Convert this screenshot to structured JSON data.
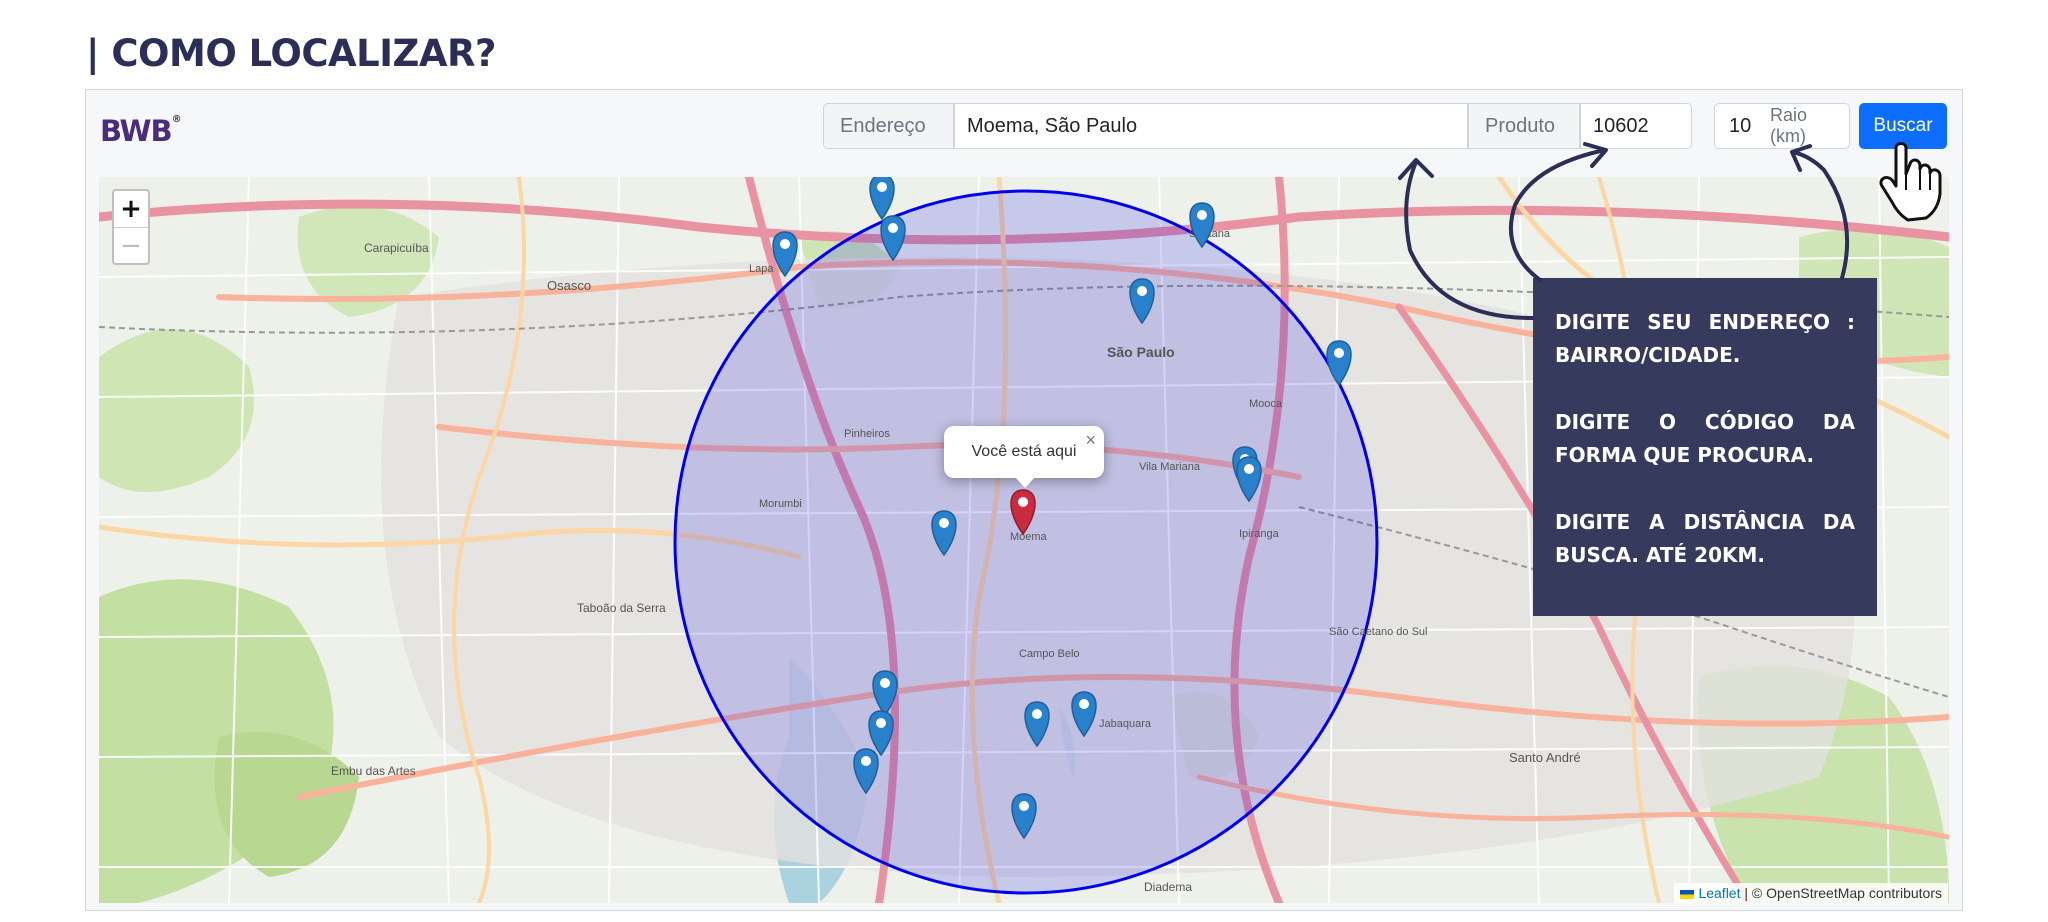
{
  "heading": "| COMO LOCALIZAR?",
  "logo": {
    "text": "BWB",
    "mark": "®"
  },
  "search": {
    "address_label": "Endereço",
    "address_value": "Moema, São Paulo",
    "product_label": "Produto",
    "product_value": "10602",
    "radius_value": "10",
    "radius_label": "Raio (km)",
    "button_label": "Buscar"
  },
  "map": {
    "zoom_in": "+",
    "zoom_out": "−",
    "popup_text": "Você está aqui",
    "popup_close": "×",
    "attribution_link": "Leaflet",
    "attribution_text": " | © OpenStreetMap contributors",
    "radius_color": "#0000ee",
    "marker_color": "#2a81cb",
    "current_marker_color": "#cb2b3e",
    "labels": {
      "center": "São Paulo",
      "moema": "Moema",
      "osasco": "Osasco",
      "santo_andre": "Santo André",
      "diadema": "Diadema",
      "embu": "Embu das Artes",
      "sao_caetano": "São Caetano do Sul",
      "pinheiros": "Pinheiros",
      "vila_mariana": "Vila Mariana",
      "ipiranga": "Ipiranga",
      "mooca": "Mooca",
      "lapa": "Lapa",
      "santana": "Santana",
      "morumbi": "Morumbi",
      "campo_belo": "Campo Belo",
      "jabaquara": "Jabaquara",
      "carapicuiba": "Carapicuíba",
      "taboao": "Taboão da Serra"
    }
  },
  "callout": {
    "line1": "DIGITE SEU ENDEREÇO : BAIRRO/CIDADE.",
    "line2": "DIGITE O CÓDIGO DA FORMA QUE PROCURA.",
    "line3": "DIGITE A DISTÂNCIA DA BUSCA. ATÉ 20KM."
  }
}
